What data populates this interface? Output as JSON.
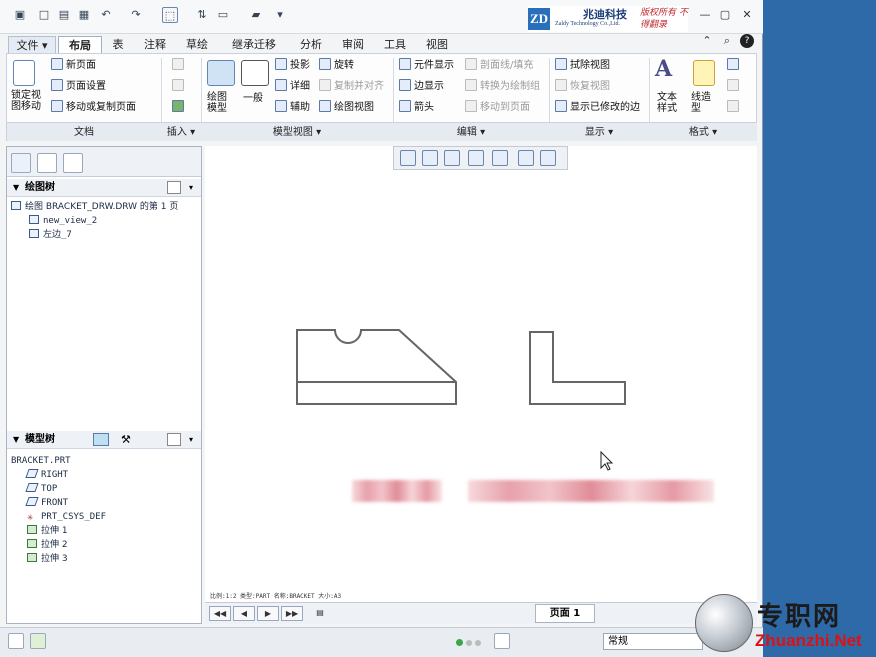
{
  "titlebar": {
    "brand_cn": "兆迪科技",
    "brand_en": "Zaldy Technology Co.,Ltd.",
    "brand_logo": "ZD",
    "brand_slogan": "版权所有 不得翻录"
  },
  "tabs": [
    "文件",
    "布局",
    "表",
    "注释",
    "草绘",
    "继承迁移",
    "分析",
    "审阅",
    "工具",
    "视图"
  ],
  "selected_tab": "布局",
  "ribbon": {
    "doc": {
      "lock": "锁定视图移动",
      "new_page": "新页面",
      "page_setup": "页面设置",
      "move_copy": "移动或复制页面",
      "group": "文档"
    },
    "insert": {
      "group": "插入"
    },
    "model_views": {
      "drawing_model": "绘图模型",
      "general": "一般",
      "projection": "投影",
      "detail": "详细",
      "auxiliary": "辅助",
      "revolve": "旋转",
      "copy_align": "复制并对齐",
      "drawing_view": "绘图视图",
      "group": "模型视图"
    },
    "edit": {
      "element_display": "元件显示",
      "edge_display": "边显示",
      "arrow": "箭头",
      "section_fill": "剖面线/填充",
      "convert": "转换为绘制组",
      "move_to_page": "移动到页面",
      "group": "编辑"
    },
    "display": {
      "erase_view": "拭除视图",
      "restore_view": "恢复视图",
      "show_modified": "显示已修改的边",
      "group": "显示"
    },
    "format": {
      "text_style": "文本样式",
      "line_style": "线造型",
      "group": "格式"
    }
  },
  "drawing_tree": {
    "header": "绘图树",
    "root": "绘图 BRACKET_DRW.DRW 的第 1 页",
    "items": [
      "new_view_2",
      "左边_7"
    ]
  },
  "model_tree": {
    "header": "模型树",
    "root": "BRACKET.PRT",
    "items": [
      "RIGHT",
      "TOP",
      "FRONT",
      "PRT_CSYS_DEF",
      "拉伸 1",
      "拉伸 2",
      "拉伸 3"
    ]
  },
  "statusline": "比例:1:2     类型:PART   名称:BRACKET   大小:A3",
  "page_tab": "页面 1",
  "mode_select": "常规",
  "watermark": {
    "cn": "专职网",
    "url": "Zhuanzhi.Net"
  }
}
